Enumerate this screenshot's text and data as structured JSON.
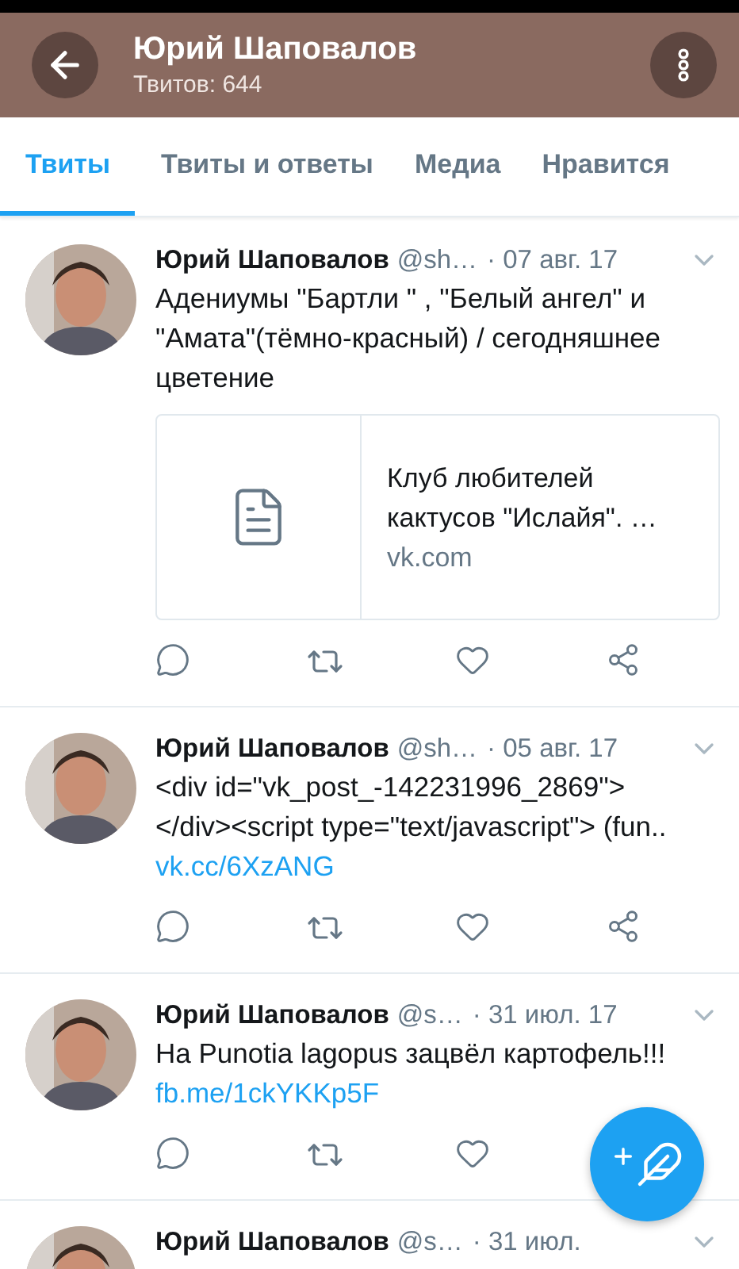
{
  "header": {
    "title": "Юрий Шаповалов",
    "subtitle": "Твитов: 644"
  },
  "tabs": [
    {
      "label": "Твиты",
      "selected": true
    },
    {
      "label": "Твиты и ответы",
      "selected": false
    },
    {
      "label": "Медиа",
      "selected": false
    },
    {
      "label": "Нравится",
      "selected": false
    }
  ],
  "tweets": [
    {
      "name": "Юрий Шаповалов",
      "handle": "@sh…",
      "date": "· 07 авг. 17",
      "text": "Адениумы \"Бартли \" , \"Белый ангел\" и \"Амата\"(тёмно-красный) / сегодняшнее цветение",
      "card": {
        "title": "Клуб любителей кактусов \"Ислайя\". …",
        "domain": "vk.com"
      }
    },
    {
      "name": "Юрий Шаповалов",
      "handle": "@sh…",
      "date": "· 05 авг. 17",
      "text": "<div id=\"vk_post_-142231996_2869\"></div><script type=\"text/javascript\"> (fun..",
      "link": "vk.cc/6XzANG"
    },
    {
      "name": "Юрий Шаповалов",
      "handle": "@s…",
      "date": "· 31 июл. 17",
      "text": "На Punotia lagopus зацвёл картофель!!!",
      "link": "fb.me/1ckYKKp5F",
      "share_shown": false
    },
    {
      "name": "Юрий Шаповалов",
      "handle": "@s…",
      "date": "· 31 июл."
    }
  ]
}
